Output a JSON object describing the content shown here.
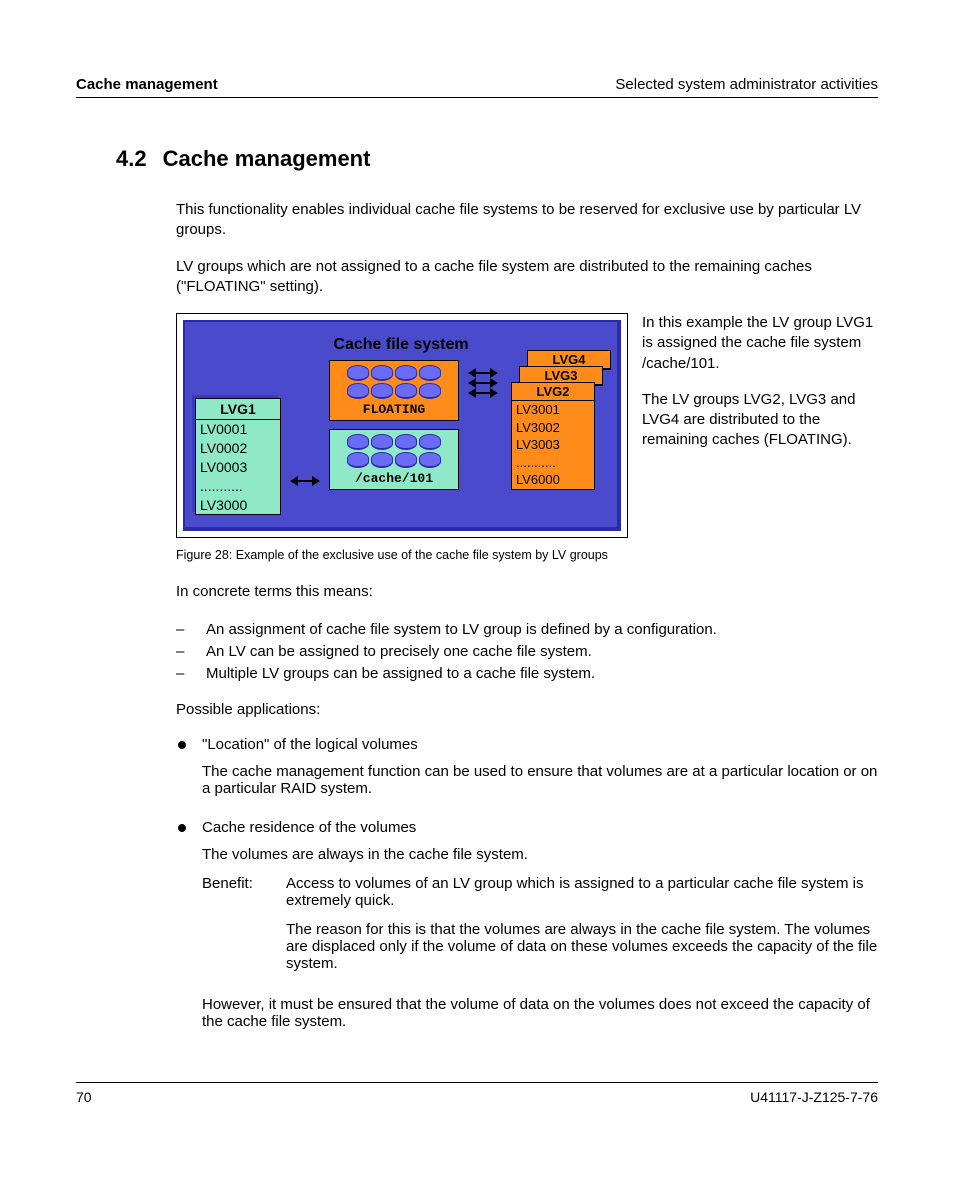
{
  "header": {
    "left": "Cache management",
    "right": "Selected system administrator activities"
  },
  "section": {
    "num": "4.2",
    "name": "Cache management"
  },
  "intro_p1": "This functionality enables individual  cache file systems to be reserved for exclusive use by particular LV groups.",
  "intro_p2": "LV groups which are not assigned to a cache file system are distributed to the remaining caches (\"FLOATING\" setting).",
  "diagram": {
    "title": "Cache file system",
    "lvg1": {
      "head": "LVG1",
      "rows": [
        "LV0001",
        "LV0002",
        "LV0003",
        "...........",
        "LV3000"
      ]
    },
    "cache_floating": "FLOATING",
    "cache_101": "/cache/101",
    "lvg4": "LVG4",
    "lvg3": "LVG3",
    "lvg2": {
      "head": "LVG2",
      "rows": [
        "LV3001",
        "LV3002",
        "LV3003",
        "...........",
        "LV6000"
      ]
    }
  },
  "side_text_p1": "In this example the LV group LVG1 is assigned the cache file system /cache/101.",
  "side_text_p2": "The LV groups LVG2, LVG3 and LVG4 are distributed to the remaining caches (FLOATING).",
  "figure_caption": "Figure 28: Example of the exclusive use of the cache file system by LV groups",
  "concrete_intro": "In concrete terms this means:",
  "dashes": [
    "An assignment of cache file system to LV group is defined by a configuration.",
    "An LV can be assigned to precisely one cache file system.",
    "Multiple LV groups can be assigned to a cache file system."
  ],
  "apps_intro": "Possible applications:",
  "bullet1_head": "\"Location\" of the logical volumes",
  "bullet1_body": "The cache management function can be used to ensure that volumes are at a particular location or on a particular RAID system.",
  "bullet2_head": "Cache residence of the volumes",
  "bullet2_p1": "The volumes are always in the cache file system.",
  "benefit_label": "Benefit:",
  "benefit_p1": "Access to volumes of an LV group which is assigned to a particular cache file system is extremely quick.",
  "benefit_p2": "The reason for this is that the volumes are always in the cache file system. The volumes are displaced only if the volume of data on these volumes exceeds the capacity of the file system.",
  "bullet2_p2": "However, it must be ensured that the volume of data on the volumes does not exceed the capacity of the cache file system.",
  "footer": {
    "page": "70",
    "docid": "U41117-J-Z125-7-76"
  }
}
